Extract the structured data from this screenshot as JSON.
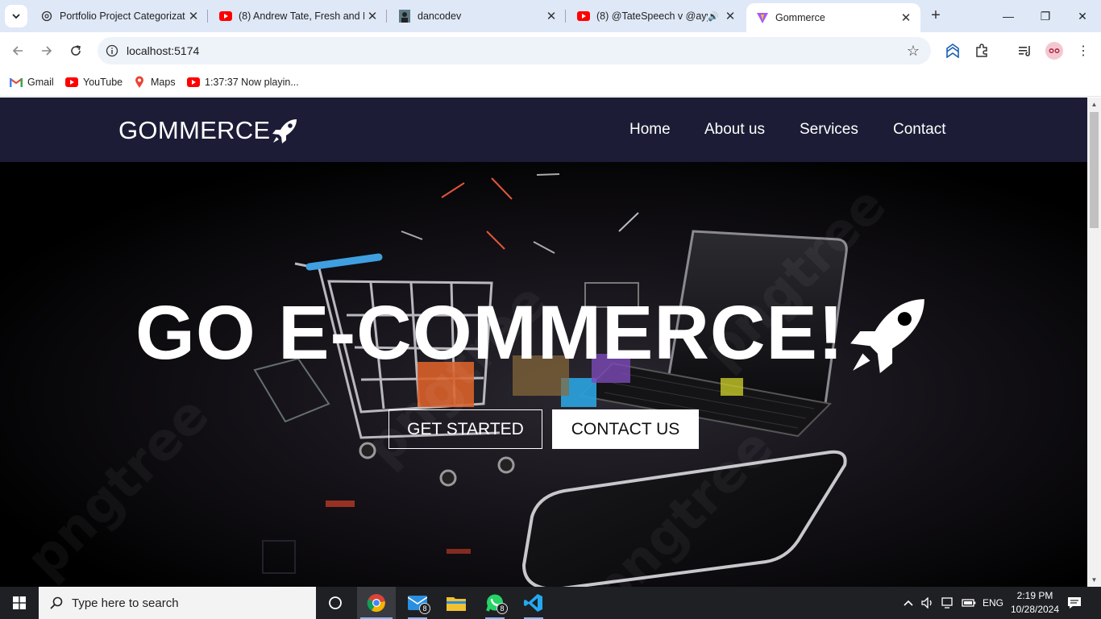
{
  "browser": {
    "tabs": [
      {
        "title": "Portfolio Project Categorizat",
        "icon": "openai-icon"
      },
      {
        "title": "(8) Andrew Tate, Fresh and F",
        "icon": "youtube-icon"
      },
      {
        "title": "dancodev",
        "icon": "avatar-icon"
      },
      {
        "title": "(8) @TateSpeech v @ayy",
        "icon": "youtube-icon"
      },
      {
        "title": "Gommerce",
        "icon": "vite-icon"
      }
    ],
    "active_tab_index": 4,
    "url": "localhost:5174",
    "bookmarks": [
      {
        "label": "Gmail",
        "icon": "gmail-icon"
      },
      {
        "label": "YouTube",
        "icon": "youtube-icon"
      },
      {
        "label": "Maps",
        "icon": "maps-icon"
      },
      {
        "label": "1:37:37 Now playin...",
        "icon": "youtube-icon"
      }
    ]
  },
  "site": {
    "logo": "GOMMERCE",
    "nav": [
      "Home",
      "About us",
      "Services",
      "Contact"
    ],
    "hero": {
      "title": "GO E-COMMERCE!",
      "primary_button": "GET STARTED",
      "secondary_button": "CONTACT US"
    },
    "colors": {
      "nav_bg": "#1c1c36",
      "hero_bg": "#000000",
      "text": "#ffffff"
    }
  },
  "taskbar": {
    "search_placeholder": "Type here to search",
    "mail_badge": "8",
    "whatsapp_badge": "8",
    "language": "ENG",
    "time": "2:19 PM",
    "date": "10/28/2024"
  }
}
